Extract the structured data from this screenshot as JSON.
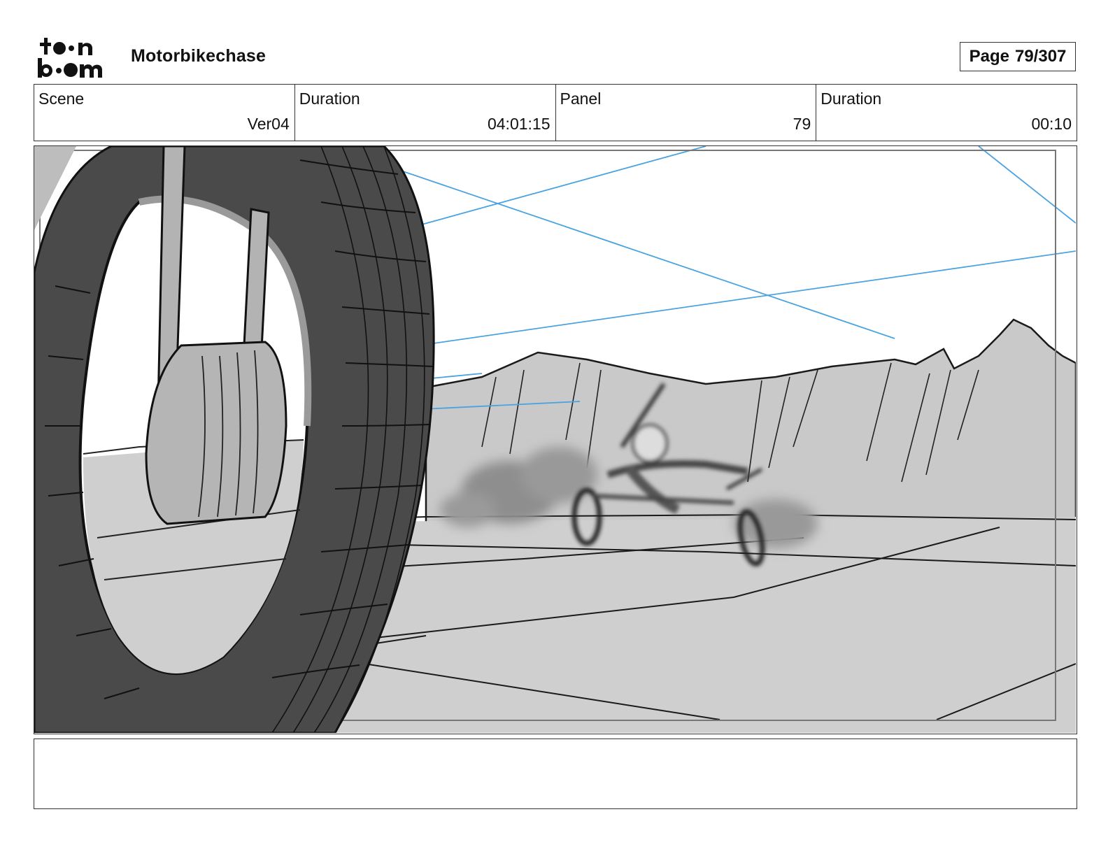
{
  "header": {
    "logo_text": "toonboom",
    "project_title": "Motorbikechase",
    "page_label": "Page",
    "page_number": "79/307"
  },
  "info": {
    "scene_label": "Scene",
    "scene_value": "Ver04",
    "scene_duration_label": "Duration",
    "scene_duration_value": "04:01:15",
    "panel_label": "Panel",
    "panel_value": "79",
    "panel_duration_label": "Duration",
    "panel_duration_value": "00:10"
  },
  "colors": {
    "sky": "#ffffff",
    "mountains": "#c9c9c9",
    "ground": "#cfcfcf",
    "tire": "#4a4a4a",
    "guide_lines": "#4aa3e0"
  },
  "notes": {
    "text": ""
  }
}
